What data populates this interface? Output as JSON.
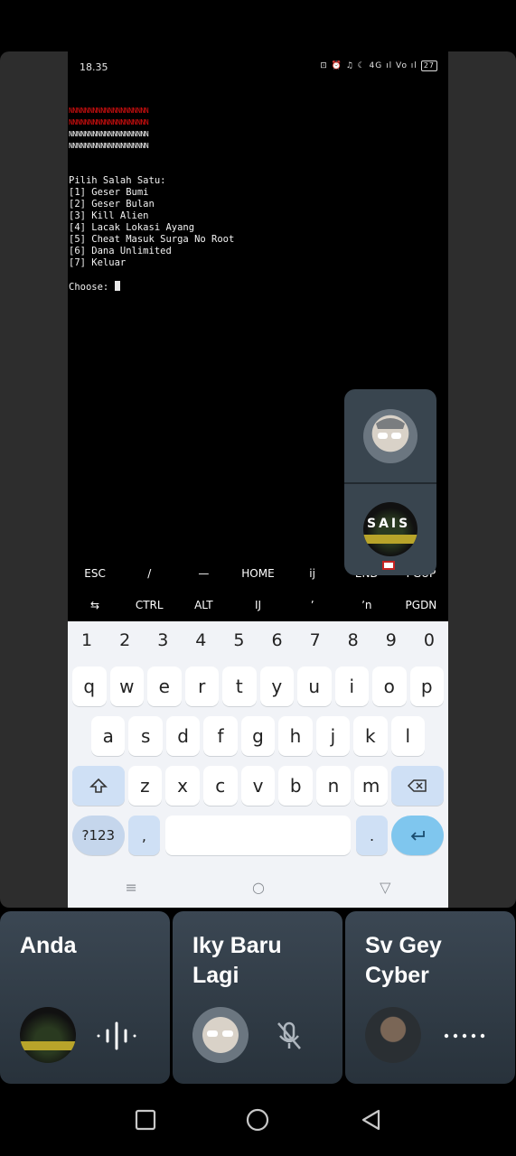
{
  "status_bar": {
    "time": "18.35",
    "icons": "⊡ ⏰ ♫ ☾ 4G ıl Vo ıl",
    "battery": "27"
  },
  "terminal": {
    "banner_red": [
      "NNNNNNNNNNNNNNNNNNNN",
      "NNNNNNNNNNNNNNNNNNNN"
    ],
    "banner_white": [
      "NNNNNNNNNNNNNNNNNNNN",
      "NNNNNNNNNNNNNNNNNNNN"
    ],
    "menu_title": "Pilih Salah Satu:",
    "options": [
      "[1] Geser Bumi",
      "[2] Geser Bulan",
      "[3] Kill Alien",
      "[4] Lacak Lokasi Ayang",
      "[5] Cheat Masuk Surga No Root",
      "[6] Dana Unlimited",
      "[7] Keluar"
    ],
    "prompt": "Choose: "
  },
  "extra_keys": {
    "row1": [
      "ESC",
      "/",
      "—",
      "HOME",
      "ij",
      "END",
      "PGUP"
    ],
    "row2": [
      "⇆",
      "CTRL",
      "ALT",
      "IJ",
      "ʼ",
      "ʼn",
      "PGDN"
    ]
  },
  "keyboard": {
    "numbers": [
      "1",
      "2",
      "3",
      "4",
      "5",
      "6",
      "7",
      "8",
      "9",
      "0"
    ],
    "row1": [
      "q",
      "w",
      "e",
      "r",
      "t",
      "y",
      "u",
      "i",
      "o",
      "p"
    ],
    "row2": [
      "a",
      "s",
      "d",
      "f",
      "g",
      "h",
      "j",
      "k",
      "l"
    ],
    "row3": [
      "z",
      "x",
      "c",
      "v",
      "b",
      "n",
      "m"
    ],
    "sym_label": "?123",
    "comma": ",",
    "period": "."
  },
  "participants": [
    {
      "name": "Anda",
      "status": "speaking"
    },
    {
      "name": "Iky Baru Lagi",
      "status": "muted"
    },
    {
      "name": "Sv Gey Cyber",
      "status": "connecting"
    }
  ],
  "floating_badge_text": "SAIS",
  "colors": {
    "terminal_red": "#e01010",
    "tile_bg": "#3b4753",
    "enter_key": "#7fc6ee"
  }
}
